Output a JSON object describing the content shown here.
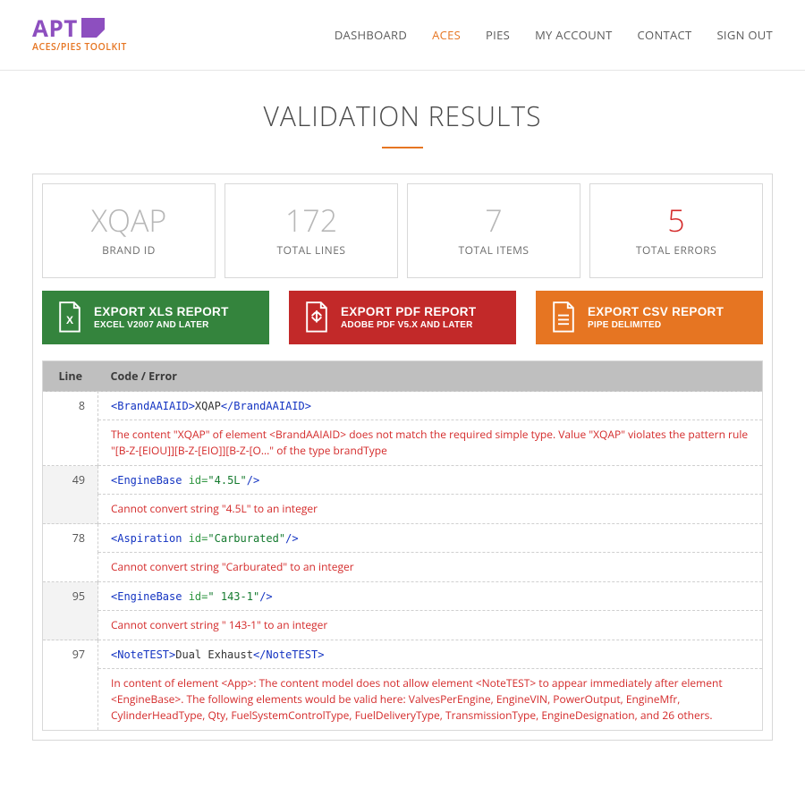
{
  "logo": {
    "text": "APT",
    "sub": "ACES/PIES TOOLKIT"
  },
  "nav": {
    "items": [
      {
        "label": "DASHBOARD",
        "active": false
      },
      {
        "label": "ACES",
        "active": true
      },
      {
        "label": "PIES",
        "active": false
      },
      {
        "label": "MY ACCOUNT",
        "active": false
      },
      {
        "label": "CONTACT",
        "active": false
      },
      {
        "label": "SIGN OUT",
        "active": false
      }
    ]
  },
  "title": "VALIDATION RESULTS",
  "stats": {
    "brand": {
      "value": "XQAP",
      "label": "BRAND ID"
    },
    "lines": {
      "value": "172",
      "label": "TOTAL LINES"
    },
    "items": {
      "value": "7",
      "label": "TOTAL ITEMS"
    },
    "errors": {
      "value": "5",
      "label": "TOTAL ERRORS"
    }
  },
  "exports": {
    "xls": {
      "title": "EXPORT XLS REPORT",
      "sub": "EXCEL V2007 AND LATER"
    },
    "pdf": {
      "title": "EXPORT PDF REPORT",
      "sub": "ADOBE PDF V5.X AND LATER"
    },
    "csv": {
      "title": "EXPORT CSV REPORT",
      "sub": "PIPE DELIMITED"
    }
  },
  "table": {
    "col_line": "Line",
    "col_err": "Code / Error",
    "rows": [
      {
        "line": "8",
        "code": {
          "openTag": "BrandAAIAID",
          "attrName": null,
          "attrValue": null,
          "inner": "XQAP",
          "selfClose": false,
          "closeTag": "BrandAAIAID"
        },
        "error": "The content \"XQAP\" of element <BrandAAIAID> does not match the required simple type. Value \"XQAP\" violates the pattern rule \"[B-Z-[EIOU]][B-Z-[EIO]][B-Z-[O...\" of the type brandType"
      },
      {
        "line": "49",
        "code": {
          "openTag": "EngineBase",
          "attrName": "id",
          "attrValue": "\"4.5L\"",
          "inner": null,
          "selfClose": true,
          "closeTag": null
        },
        "error": "Cannot convert string \"4.5L\" to an integer"
      },
      {
        "line": "78",
        "code": {
          "openTag": "Aspiration",
          "attrName": "id",
          "attrValue": "\"Carburated\"",
          "inner": null,
          "selfClose": true,
          "closeTag": null
        },
        "error": "Cannot convert string \"Carburated\" to an integer"
      },
      {
        "line": "95",
        "code": {
          "openTag": "EngineBase",
          "attrName": "id",
          "attrValue": "\" 143-1\"",
          "inner": null,
          "selfClose": true,
          "closeTag": null
        },
        "error": "Cannot convert string \" 143-1\" to an integer"
      },
      {
        "line": "97",
        "code": {
          "openTag": "NoteTEST",
          "attrName": null,
          "attrValue": null,
          "inner": "Dual Exhaust",
          "selfClose": false,
          "closeTag": "NoteTEST"
        },
        "error": "In content of element <App>: The content model does not allow element <NoteTEST> to appear immediately after element <EngineBase>. The following elements would be valid here: ValvesPerEngine, EngineVIN, PowerOutput, EngineMfr, CylinderHeadType, Qty, FuelSystemControlType, FuelDeliveryType, TransmissionType, EngineDesignation, and 26 others."
      }
    ]
  }
}
